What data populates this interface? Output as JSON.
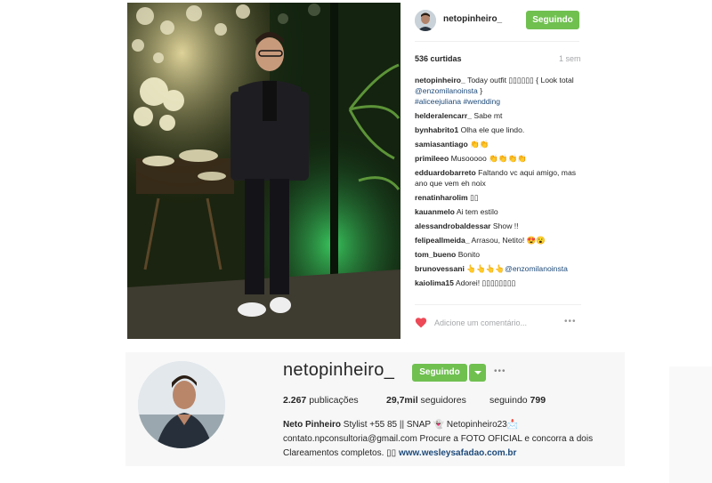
{
  "post": {
    "owner": "netopinheiro_",
    "follow_label": "Seguindo",
    "likes": "536 curtidas",
    "time_ago": "1 sem",
    "caption": {
      "user": "netopinheiro_",
      "text": "Today outfit ▯▯▯▯▯▯ {",
      "text2": "Look total",
      "mention": "@enzomilanoinsta",
      "text3": "}",
      "hashtags": "#aliceejuliana #wendding"
    },
    "comments": [
      {
        "user": "helderalencarr_",
        "text": "Sabe mt"
      },
      {
        "user": "bynhabrito1",
        "text": "Olha ele que lindo."
      },
      {
        "user": "samiasantiago",
        "text": "👏👏"
      },
      {
        "user": "primileeo",
        "text": "Musooooo 👏👏👏👏"
      },
      {
        "user": "edduardobarreto",
        "text": "Faltando vc aqui amigo, mas ano que vem eh noix"
      },
      {
        "user": "renatinharolim",
        "text": "▯▯"
      },
      {
        "user": "kauanmelo",
        "text": "Ai tem estilo"
      },
      {
        "user": "alessandrobaldessar",
        "text": "Show !!"
      },
      {
        "user": "felipeallmeida_",
        "text": "Arrasou, Netito! 😍😮"
      },
      {
        "user": "tom_bueno",
        "text": "Bonito"
      },
      {
        "user": "brunovessani",
        "text": "👆👆👆👆",
        "mention": "@enzomilanoinsta"
      },
      {
        "user": "kaiolima15",
        "text": "Adorei! ▯▯▯▯▯▯▯▯"
      }
    ],
    "add_comment_placeholder": "Adicione um comentário...",
    "more": "•••"
  },
  "profile": {
    "username": "netopinheiro_",
    "follow_label": "Seguindo",
    "more": "•••",
    "posts_count": "2.267",
    "posts_label": "publicações",
    "followers_count": "29,7mil",
    "followers_label": "seguidores",
    "following_label": "seguindo",
    "following_count": "799",
    "bio_name": "Neto Pinheiro",
    "bio_text": "Stylist +55 85 || SNAP 👻 Netopinheiro23📩 contato.npconsultoria@gmail.com Procure a FOTO OFICIAL e concorra a dois Clareamentos completos. ▯▯",
    "bio_link": "www.wesleysafadao.com.br"
  },
  "icons": {
    "heart": "heart-icon",
    "more": "more-icon",
    "caret": "chevron-down-icon"
  },
  "colors": {
    "follow_green": "#70c050",
    "link_blue": "#1d4a7a",
    "heart_red": "#ed4956"
  }
}
